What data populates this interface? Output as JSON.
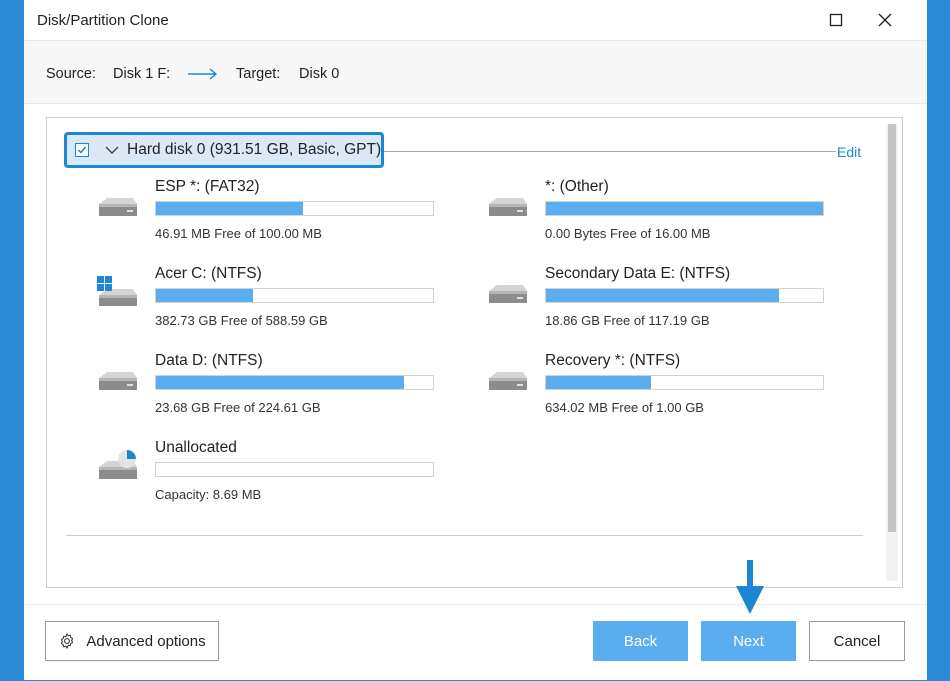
{
  "window": {
    "title": "Disk/Partition Clone"
  },
  "header": {
    "source_label": "Source:",
    "source_value": "Disk 1 F:",
    "target_label": "Target:",
    "target_value": "Disk 0"
  },
  "disk": {
    "label": "Hard disk 0 (931.51 GB, Basic, GPT)",
    "checked": true,
    "edit_label": "Edit"
  },
  "partitions": [
    {
      "name": "ESP *: (FAT32)",
      "info": "46.91 MB Free of 100.00 MB",
      "used_fraction": 0.53,
      "icon": "drive-icon"
    },
    {
      "name": "*: (Other)",
      "info": "0.00 Bytes Free of 16.00 MB",
      "used_fraction": 1.0,
      "icon": "drive-icon"
    },
    {
      "name": "Acer C: (NTFS)",
      "info": "382.73 GB Free of 588.59 GB",
      "used_fraction": 0.35,
      "icon": "windows-drive-icon"
    },
    {
      "name": "Secondary Data E: (NTFS)",
      "info": "18.86 GB Free of 117.19 GB",
      "used_fraction": 0.84,
      "icon": "drive-icon"
    },
    {
      "name": "Data  D: (NTFS)",
      "info": "23.68 GB Free of 224.61 GB",
      "used_fraction": 0.895,
      "icon": "drive-icon"
    },
    {
      "name": "Recovery *: (NTFS)",
      "info": "634.02 MB Free of 1.00 GB",
      "used_fraction": 0.38,
      "icon": "drive-icon"
    },
    {
      "name": "Unallocated",
      "info": "Capacity: 8.69 MB",
      "used_fraction": 0.0,
      "icon": "unallocated-drive-icon"
    }
  ],
  "footer": {
    "advanced_label": "Advanced options",
    "back_label": "Back",
    "next_label": "Next",
    "cancel_label": "Cancel"
  },
  "colors": {
    "accent": "#1b87d2",
    "bar_fill": "#5aaef0",
    "background": "#2b8ad6"
  }
}
